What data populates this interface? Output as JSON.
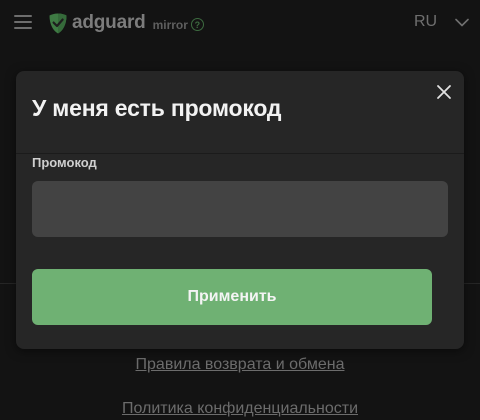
{
  "header": {
    "menu_icon": "hamburger-menu-icon",
    "logo_icon": "adguard-shield-icon",
    "logo_text": "adguard",
    "mirror_label": "mirror",
    "help_icon_glyph": "?",
    "language": "RU",
    "language_icon": "chevron-down-icon"
  },
  "modal": {
    "title": "У меня есть промокод",
    "close_icon": "close-icon",
    "promo_label": "Промокод",
    "promo_value": "",
    "apply_label": "Применить"
  },
  "footer": {
    "links": [
      "Правила возврата и обмена",
      "Политика конфиденциальности"
    ]
  },
  "colors": {
    "background": "#131313",
    "modal_bg": "#262626",
    "input_bg": "#434343",
    "accent": "#6fb173",
    "title_text": "#f2f2f2"
  }
}
